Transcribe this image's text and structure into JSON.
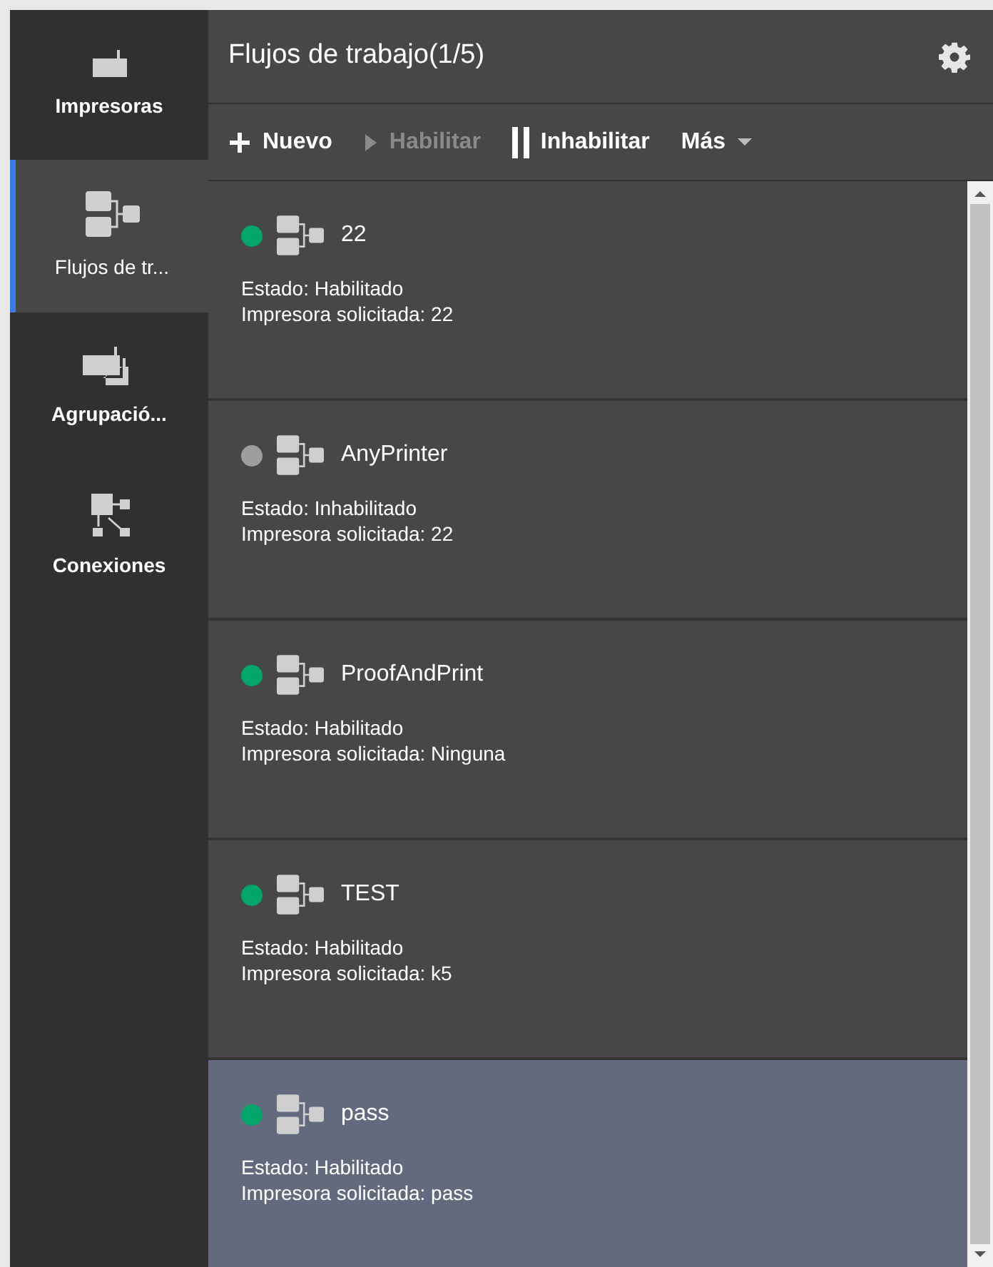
{
  "sidebar": {
    "items": [
      {
        "label": "Impresoras",
        "kind": "printer",
        "selected": false
      },
      {
        "label": "Flujos de tr...",
        "kind": "workflow",
        "selected": true
      },
      {
        "label": "Agrupació...",
        "kind": "group",
        "selected": false
      },
      {
        "label": "Conexiones",
        "kind": "connections",
        "selected": false
      }
    ]
  },
  "header": {
    "title": "Flujos de trabajo(1/5)"
  },
  "toolbar": [
    {
      "label": "Nuevo",
      "kind": "new",
      "disabled": false
    },
    {
      "label": "Habilitar",
      "kind": "enable",
      "disabled": true
    },
    {
      "label": "Inhabilitar",
      "kind": "disable",
      "disabled": false
    },
    {
      "label": "Más",
      "kind": "more",
      "disabled": false
    }
  ],
  "workflows": [
    {
      "name": "22",
      "enabled": true,
      "status": "Estado: Habilitado",
      "printer": "Impresora solicitada: 22",
      "selected": false
    },
    {
      "name": "AnyPrinter",
      "enabled": false,
      "status": "Estado: Inhabilitado",
      "printer": "Impresora solicitada: 22",
      "selected": false
    },
    {
      "name": "ProofAndPrint",
      "enabled": true,
      "status": "Estado: Habilitado",
      "printer": "Impresora solicitada: Ninguna",
      "selected": false
    },
    {
      "name": "TEST",
      "enabled": true,
      "status": "Estado: Habilitado",
      "printer": "Impresora solicitada: k5",
      "selected": false
    },
    {
      "name": "pass",
      "enabled": true,
      "status": "Estado: Habilitado",
      "printer": "Impresora solicitada: pass",
      "selected": true
    }
  ]
}
